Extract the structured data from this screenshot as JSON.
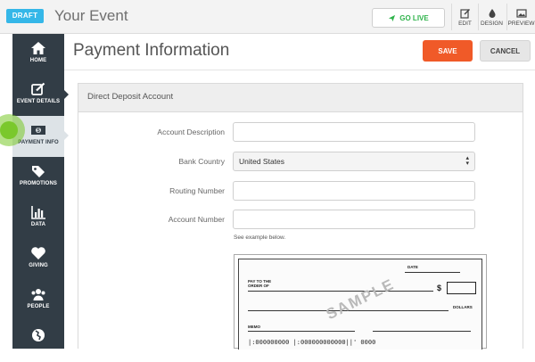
{
  "topbar": {
    "status_badge": "DRAFT",
    "event_title": "Your Event",
    "go_live_label": "GO LIVE",
    "edit_label": "EDIT",
    "design_label": "DESIGN",
    "preview_label": "PREVIEW"
  },
  "sidebar": {
    "items": [
      {
        "label": "HOME",
        "icon": "home-icon"
      },
      {
        "label": "EVENT DETAILS",
        "icon": "edit-icon"
      },
      {
        "label": "PAYMENT INFO",
        "icon": "money-icon",
        "active": true
      },
      {
        "label": "PROMOTIONS",
        "icon": "tag-icon"
      },
      {
        "label": "DATA",
        "icon": "bar-chart-icon"
      },
      {
        "label": "GIVING",
        "icon": "heart-icon"
      },
      {
        "label": "PEOPLE",
        "icon": "people-icon"
      },
      {
        "label": "",
        "icon": "globe-icon"
      }
    ]
  },
  "header": {
    "title": "Payment Information",
    "save_label": "SAVE",
    "cancel_label": "CANCEL"
  },
  "panel": {
    "title": "Direct Deposit Account",
    "fields": {
      "account_description": {
        "label": "Account Description",
        "value": ""
      },
      "bank_country": {
        "label": "Bank Country",
        "value": "United States"
      },
      "routing_number": {
        "label": "Routing Number",
        "value": ""
      },
      "account_number": {
        "label": "Account Number",
        "value": ""
      }
    },
    "hint": "See example below."
  },
  "check": {
    "pay_to": "PAY TO THE",
    "order_of": "ORDER OF",
    "date": "DATE",
    "dollar_sign": "$",
    "dollars": "DOLLARS",
    "memo": "MEMO",
    "watermark": "SAMPLE",
    "micr": "|:000000000 |:000000000000||' 0000"
  },
  "colors": {
    "accent_orange": "#f05a28",
    "sidebar_bg": "#323d46",
    "draft_blue": "#35b7e8",
    "go_live_green": "#2fb34b"
  }
}
